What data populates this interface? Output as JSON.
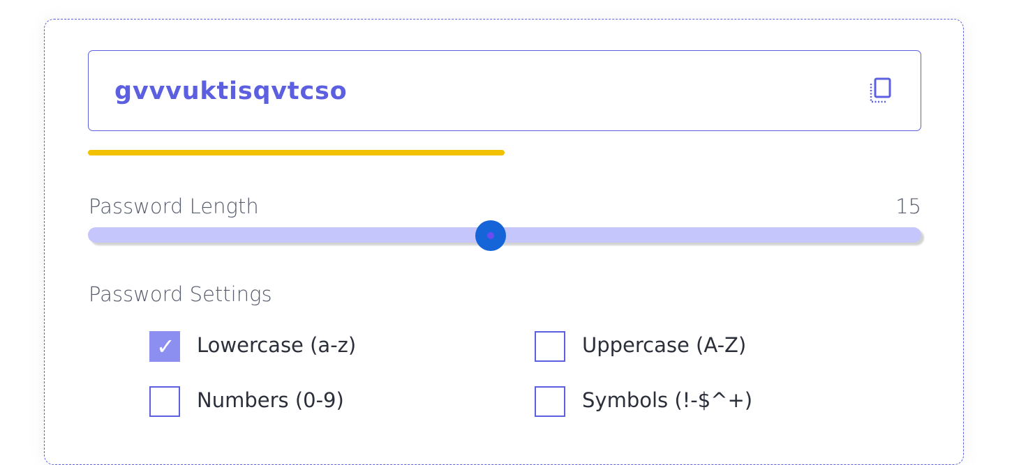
{
  "generator": {
    "password": "gvvvuktisqvtcso",
    "copy_icon": "copy-icon",
    "strength": {
      "level": 0.5,
      "color": "#f2c200"
    }
  },
  "length": {
    "label": "Password Length",
    "value": "15",
    "min": 1,
    "max": 30,
    "track_color": "#c5c6fb",
    "thumb_color": "#1565d8"
  },
  "settings": {
    "label": "Password Settings",
    "options": [
      {
        "label": "Lowercase (a-z)",
        "checked": true
      },
      {
        "label": "Uppercase (A-Z)",
        "checked": false
      },
      {
        "label": "Numbers (0-9)",
        "checked": false
      },
      {
        "label": "Symbols (!-$^+)",
        "checked": false
      }
    ]
  },
  "colors": {
    "accent": "#5b5fe0",
    "checked_fill": "#8c8ff0"
  }
}
